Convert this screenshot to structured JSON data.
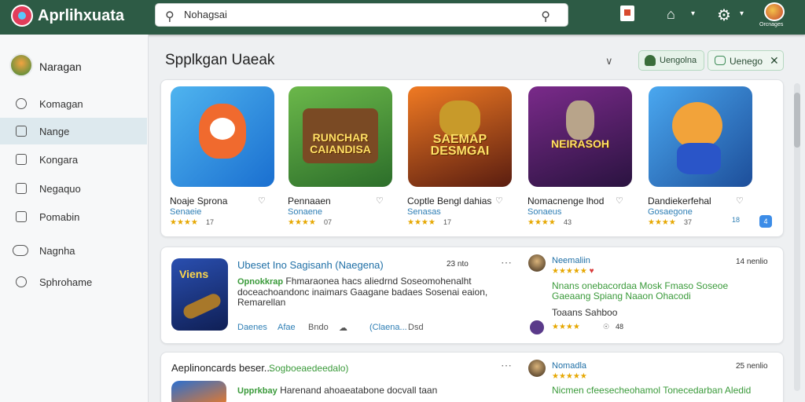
{
  "app": {
    "title": "Aprlihxuata",
    "brand_color": "#2d5b45"
  },
  "search": {
    "value": "Nohagsai",
    "placeholder": "Nohagsai"
  },
  "topbar": {
    "avatar_label": "Orcnages"
  },
  "sidebar": {
    "user": "Naragan",
    "items": [
      {
        "label": "Komagan",
        "icon": "home-icon"
      },
      {
        "label": "Nange",
        "icon": "game-icon",
        "active": true
      },
      {
        "label": "Kongara",
        "icon": "store-icon"
      },
      {
        "label": "Negaquo",
        "icon": "bookmark-icon"
      },
      {
        "label": "Pomabin",
        "icon": "grid-icon"
      },
      {
        "label": "Nagnha",
        "icon": "link-icon"
      },
      {
        "label": "Sphrohame",
        "icon": "settings-icon"
      }
    ]
  },
  "main": {
    "title": "Spplkgan Uaeak",
    "pill1": "Uengolna",
    "pill2": "Uenego"
  },
  "featured": [
    {
      "name": "Noaje Sprona",
      "category": "Senaeie",
      "rating": 4,
      "reviews": "17",
      "thumb_text": "",
      "colors": [
        "#4fb4ef",
        "#1a6fd0"
      ]
    },
    {
      "name": "Pennaaen",
      "category": "Sonaene",
      "rating": 4,
      "reviews": "07",
      "thumb_text": "RUNCHAR CAIANDISA",
      "colors": [
        "#6bb84a",
        "#2c6e2a"
      ]
    },
    {
      "name": "Coptle Bengl dahias",
      "category": "Senasas",
      "rating": 4,
      "reviews": "17",
      "thumb_text": "SAEMAP DESMGAI",
      "colors": [
        "#f07a23",
        "#5a1d10"
      ]
    },
    {
      "name": "Nomacnenge lhod",
      "category": "Sonaeus",
      "rating": 4,
      "reviews": "43",
      "thumb_text": "NEIRASOH",
      "colors": [
        "#7a2a8a",
        "#2a1340"
      ]
    },
    {
      "name": "Dandiekerfehal",
      "category": "Gosaegone",
      "rating": 4,
      "reviews": "37",
      "thumb_text": "",
      "colors": [
        "#4aa8f0",
        "#1d4e9a"
      ]
    }
  ],
  "featured_extra": {
    "count": "18",
    "badge": "4"
  },
  "list1": {
    "title": "Ubeset Ino Sagisanh (Naegena)",
    "time": "23 nto",
    "thumb_text": "Viens",
    "tag": "Opnokkrap",
    "desc": "Fhmaraonea hacs aliedrnd Soseomohenalht doceachoandonc inaimars Gaagane badaes Sosenai eaion, Remarellan",
    "meta": [
      "Daenes",
      "Afae",
      "Bndo",
      "(Claena...",
      "Dsd"
    ],
    "review": {
      "name": "Neemaliin",
      "time": "14 nenlio",
      "stars": 5,
      "text": "Nnans onebacordaa Mosk Fmaso Soseoe Gaeaang Spiang Naaon Ohacodi",
      "sub": "Toaans Sahboo",
      "stars2": 4,
      "count": "48"
    }
  },
  "list2": {
    "title": "Aeplinoncards beser...",
    "subtitle": "Sogboeaedeedalo)",
    "tag": "Upprkbay",
    "desc": "Harenand ahoaeatabone docvall taan",
    "review": {
      "name": "Nomadla",
      "time": "25 nenlio",
      "stars": 5,
      "text": "Nicmen cfeesecheohamol Tonecedarban Aledid"
    }
  }
}
